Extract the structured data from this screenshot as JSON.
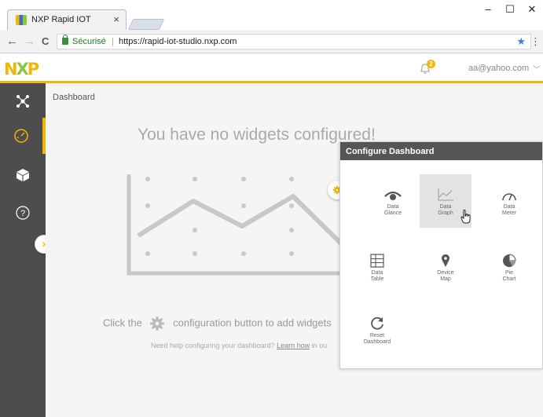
{
  "browser": {
    "tab_title": "NXP Rapid IOT",
    "tab_close": "×",
    "minimize": "–",
    "maximize": "☐",
    "close": "✕",
    "back": "←",
    "forward": "→",
    "reload": "C",
    "secure_label": "Sécurisé",
    "separator": "|",
    "url": "https://rapid-iot-studio.nxp.com",
    "bookmark": "★",
    "menu": "⋮"
  },
  "header": {
    "logo": {
      "n": "N",
      "x": "X",
      "p": "P"
    },
    "notification_count": "2",
    "user_email": "aa@yahoo.com",
    "user_chevron": "﹀",
    "colors": {
      "accent": "#f2b705",
      "green": "#8cc63f",
      "sidebar": "#4d4d4d",
      "panel_header": "#555555"
    }
  },
  "sidebar": {
    "items": [
      {
        "icon": "network-icon"
      },
      {
        "icon": "dashboard-gauge-icon",
        "active": true
      },
      {
        "icon": "cube-icon"
      },
      {
        "icon": "help-icon",
        "glyph": "?"
      }
    ],
    "expand_glyph": "›"
  },
  "main": {
    "breadcrumb": "Dashboard",
    "empty_title": "You have no widgets configured!",
    "hint_before": "Click the",
    "hint_after": "configuration button to add widgets",
    "help_before": "Need help configuring your dashboard?",
    "help_link": "Learn how",
    "help_after": "in ou"
  },
  "panel": {
    "title": "Configure Dashboard",
    "widgets": [
      {
        "label": "Data\nGlance",
        "icon": "eye-icon"
      },
      {
        "label": "Data\nGraph",
        "icon": "line-graph-icon",
        "hovered": true
      },
      {
        "label": "Data\nMeter",
        "icon": "meter-icon"
      },
      {
        "label": "Data\nTable",
        "icon": "table-icon"
      },
      {
        "label": "Device\nMap",
        "icon": "map-pin-icon"
      },
      {
        "label": "Pie\nChart",
        "icon": "pie-chart-icon"
      },
      {
        "label": "Reset\nDashboard",
        "icon": "reset-icon"
      }
    ]
  }
}
